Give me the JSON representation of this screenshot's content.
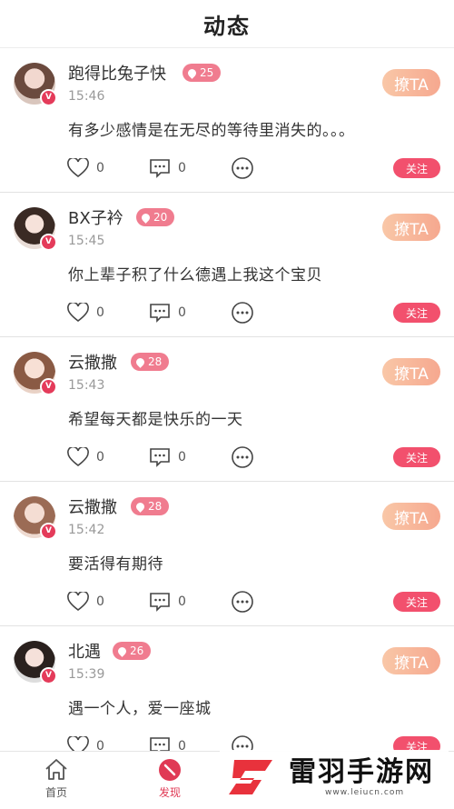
{
  "header": {
    "title": "动态"
  },
  "posts": [
    {
      "name": "跑得比兔子快",
      "level": "25",
      "time": "15:46",
      "content": "有多少感情是在无尽的等待里消失的。。。",
      "likes": "0",
      "comments": "0",
      "flirt": "撩TA",
      "follow": "关注",
      "badge": "V"
    },
    {
      "name": "BX子衿",
      "level": "20",
      "time": "15:45",
      "content": "你上辈子积了什么德遇上我这个宝贝",
      "likes": "0",
      "comments": "0",
      "flirt": "撩TA",
      "follow": "关注",
      "badge": "V"
    },
    {
      "name": "云撒撒",
      "level": "28",
      "time": "15:43",
      "content": "希望每天都是快乐的一天",
      "likes": "0",
      "comments": "0",
      "flirt": "撩TA",
      "follow": "关注",
      "badge": "V"
    },
    {
      "name": "云撒撒",
      "level": "28",
      "time": "15:42",
      "content": "要活得有期待",
      "likes": "0",
      "comments": "0",
      "flirt": "撩TA",
      "follow": "关注",
      "badge": "V"
    },
    {
      "name": "北遇",
      "level": "26",
      "time": "15:39",
      "content": "遇一个人，爱一座城",
      "likes": "0",
      "comments": "0",
      "flirt": "撩TA",
      "follow": "关注",
      "badge": "V"
    }
  ],
  "tabbar": {
    "home": "首页",
    "discover": "发现"
  },
  "watermark": {
    "text": "雷羽手游网",
    "url": "www.leiucn.com"
  },
  "colors": {
    "accent": "#f2506d",
    "level": "#f07c8f",
    "flirt": "#f6a88f"
  }
}
